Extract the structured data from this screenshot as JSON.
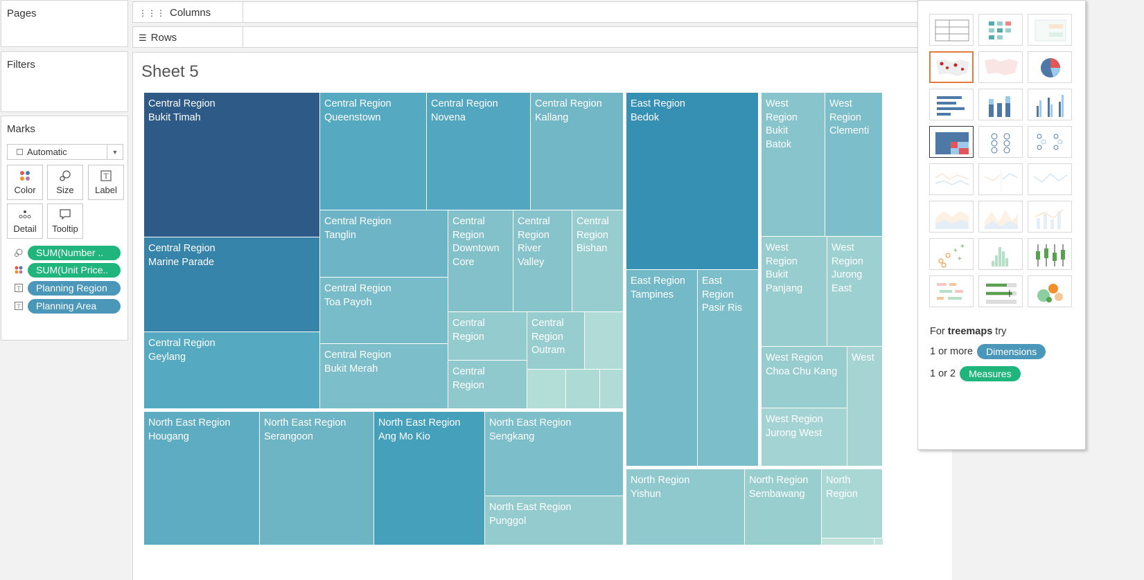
{
  "panels": {
    "pages": "Pages",
    "filters": "Filters",
    "marks": "Marks"
  },
  "shelves": {
    "columns": "Columns",
    "rows": "Rows"
  },
  "marks": {
    "type_dropdown": "Automatic",
    "buttons": {
      "color": "Color",
      "size": "Size",
      "label": "Label",
      "detail": "Detail",
      "tooltip": "Tooltip"
    },
    "pills": [
      {
        "text": "SUM(Number ..",
        "icon": "size-icon",
        "color": "#1fb57c"
      },
      {
        "text": "SUM(Unit Price..",
        "icon": "color-icon",
        "color": "#1fb57c"
      },
      {
        "text": "Planning Region",
        "icon": "label-icon",
        "color": "#4a97b9"
      },
      {
        "text": "Planning Area",
        "icon": "label-icon",
        "color": "#4a97b9"
      }
    ]
  },
  "sheet": {
    "title": "Sheet 5"
  },
  "treemap": {
    "tiles": [
      {
        "region": "Central Region",
        "area": "Bukit Timah",
        "label": "Central Region\nBukit Timah",
        "color": "#2e5a87"
      },
      {
        "region": "Central Region",
        "area": "Marine Parade",
        "label": "Central Region\nMarine Parade",
        "color": "#3784ab"
      },
      {
        "region": "Central Region",
        "area": "Geylang",
        "label": "Central Region\nGeylang",
        "color": "#55a9c0"
      },
      {
        "region": "Central Region",
        "area": "Queenstown",
        "label": "Central Region\nQueenstown",
        "color": "#55a9c0"
      },
      {
        "region": "Central Region",
        "area": "Novena",
        "label": "Central Region\nNovena",
        "color": "#52a6bf"
      },
      {
        "region": "Central Region",
        "area": "Kallang",
        "label": "Central Region\nKallang",
        "color": "#72b7c6"
      },
      {
        "region": "Central Region",
        "area": "Tanglin",
        "label": "Central Region\nTanglin",
        "color": "#6db5c6"
      },
      {
        "region": "Central Region",
        "area": "Toa Payoh",
        "label": "Central Region\nToa Payoh",
        "color": "#78bcc9"
      },
      {
        "region": "Central Region",
        "area": "Bukit Merah",
        "label": "Central Region\nBukit Merah",
        "color": "#7cbec9"
      },
      {
        "region": "Central Region",
        "area": "Downtown Core",
        "label": "Central\nRegion\nDowntown\nCore",
        "color": "#82c1ca"
      },
      {
        "region": "Central Region",
        "area": "River Valley",
        "label": "Central\nRegion\nRiver\nValley",
        "color": "#86c3cb"
      },
      {
        "region": "Central Region",
        "area": "Bishan",
        "label": "Central\nRegion\nBishan",
        "color": "#98cdcf"
      },
      {
        "region": "Central Region",
        "area": "",
        "label": "Central\nRegion",
        "color": "#94cbce"
      },
      {
        "region": "Central Region",
        "area": "Outram",
        "label": "Central\nRegion\nOutram",
        "color": "#98cdcf"
      },
      {
        "region": "Central Region",
        "area": "",
        "label": "",
        "color": "#b0dbd6"
      },
      {
        "region": "Central Region",
        "area": "",
        "label": "Central\nRegion",
        "color": "#90c9cd"
      },
      {
        "region": "Central Region",
        "area": "",
        "label": "",
        "color": "#b3ddd7"
      },
      {
        "region": "Central Region",
        "area": "",
        "label": "",
        "color": "#addad5"
      },
      {
        "region": "Central Region",
        "area": "",
        "label": "",
        "color": "#b0dbd6"
      },
      {
        "region": "North East Region",
        "area": "Hougang",
        "label": "North East Region\nHougang",
        "color": "#5dacc2"
      },
      {
        "region": "North East Region",
        "area": "Serangoon",
        "label": "North East Region\nSerangoon",
        "color": "#6db5c5"
      },
      {
        "region": "North East Region",
        "area": "Ang Mo Kio",
        "label": "North East Region\nAng Mo Kio",
        "color": "#45a0bb"
      },
      {
        "region": "North East Region",
        "area": "Sengkang",
        "label": "North East Region\nSengkang",
        "color": "#7cbec9"
      },
      {
        "region": "North East Region",
        "area": "Punggol",
        "label": "North East Region\nPunggol",
        "color": "#94cbce"
      },
      {
        "region": "East Region",
        "area": "Bedok",
        "label": "East Region\nBedok",
        "color": "#3690b4"
      },
      {
        "region": "East Region",
        "area": "Tampines",
        "label": "East Region\nTampines",
        "color": "#74b9c7"
      },
      {
        "region": "East Region",
        "area": "Pasir Ris",
        "label": "East\nRegion\nPasir Ris",
        "color": "#7cbec9"
      },
      {
        "region": "West Region",
        "area": "Bukit Batok",
        "label": "West\nRegion\nBukit\nBatok",
        "color": "#88c4cb"
      },
      {
        "region": "West Region",
        "area": "Clementi",
        "label": "West\nRegion\nClementi",
        "color": "#7cbec9"
      },
      {
        "region": "West Region",
        "area": "Bukit Panjang",
        "label": "West\nRegion\nBukit\nPanjang",
        "color": "#98cdcf"
      },
      {
        "region": "West Region",
        "area": "Jurong East",
        "label": "West\nRegion\nJurong\nEast",
        "color": "#9dd0d0"
      },
      {
        "region": "West Region",
        "area": "Choa Chu Kang",
        "label": "West Region\nChoa Chu Kang",
        "color": "#98cdcf"
      },
      {
        "region": "West Region",
        "area": "",
        "label": "West",
        "color": "#a5d4d2"
      },
      {
        "region": "West Region",
        "area": "Jurong West",
        "label": "West Region\nJurong West",
        "color": "#a3d3d2"
      },
      {
        "region": "North Region",
        "area": "Yishun",
        "label": "North Region\nYishun",
        "color": "#8fc8cd"
      },
      {
        "region": "North Region",
        "area": "Sembawang",
        "label": "North Region\nSembawang",
        "color": "#99cecf"
      },
      {
        "region": "North Region",
        "area": "",
        "label": "North\nRegion",
        "color": "#a9d7d4"
      },
      {
        "region": "North Region",
        "area": "",
        "label": "",
        "color": "#bfe2db"
      },
      {
        "region": "North Region",
        "area": "",
        "label": "",
        "color": "#c4e5dd"
      }
    ]
  },
  "show_me": {
    "thumbs": [
      "text-table-icon",
      "heat-map-icon",
      "highlight-table-icon",
      "symbol-map-icon",
      "filled-map-icon",
      "pie-chart-icon",
      "horizontal-bars-icon",
      "stacked-bars-icon",
      "side-by-side-bars-icon",
      "treemap-icon",
      "circle-views-icon",
      "side-by-side-circles-icon",
      "lines-continuous-icon",
      "lines-discrete-icon",
      "dual-lines-icon",
      "area-continuous-icon",
      "area-discrete-icon",
      "dual-combination-icon",
      "scatter-plot-icon",
      "histogram-icon",
      "box-whisker-icon",
      "gantt-chart-icon",
      "bullet-graph-icon",
      "packed-bubbles-icon"
    ],
    "selected_index": 3,
    "active_index": 9,
    "hint_prefix": "For ",
    "hint_bold": "treemaps",
    "hint_suffix": " try",
    "dim_prefix": "1 or more",
    "dim_label": "Dimensions",
    "meas_prefix": "1 or 2",
    "meas_label": "Measures",
    "dim_color": "#4a97b9",
    "meas_color": "#1fb57c"
  }
}
